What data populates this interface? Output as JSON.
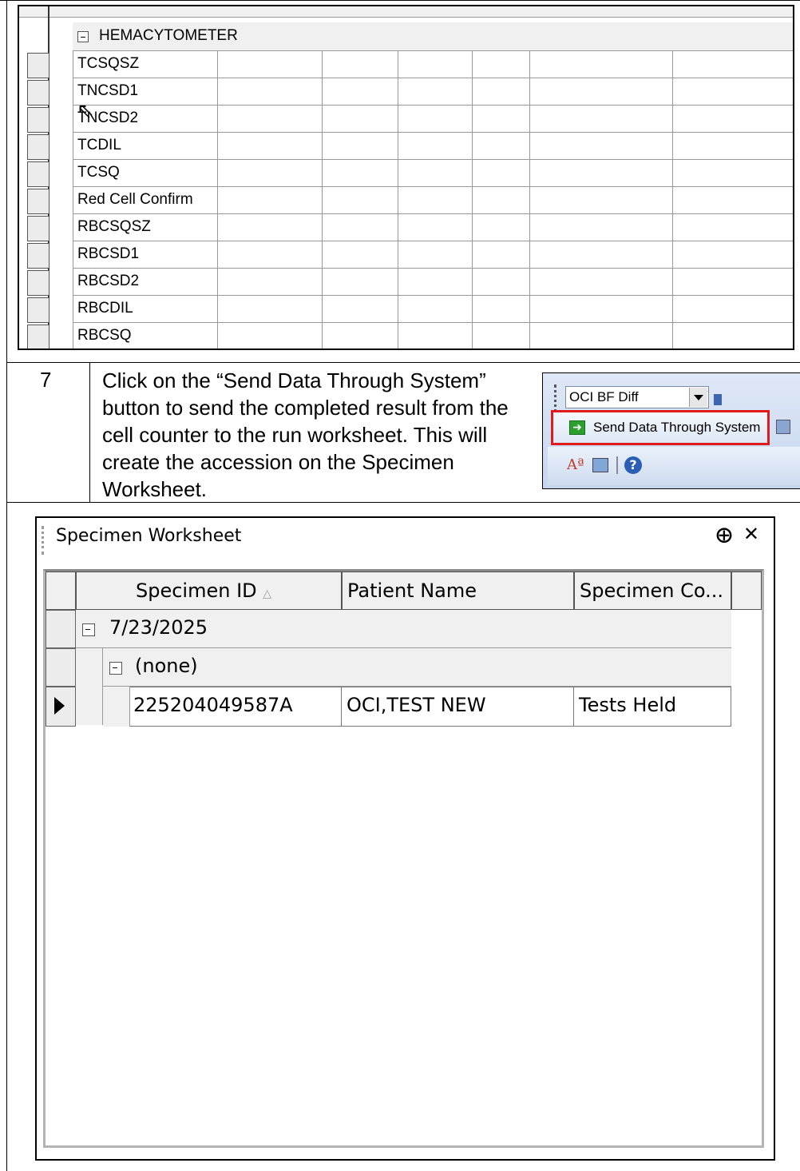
{
  "grid": {
    "group_label": "HEMACYTOMETER",
    "rows": [
      "TCSQSZ",
      "TNCSD1",
      "TNCSD2",
      "TCDIL",
      "TCSQ",
      "Red Cell Confirm",
      "RBCSQSZ",
      "RBCSD1",
      "RBCSD2",
      "RBCDIL",
      "RBCSQ"
    ]
  },
  "step": {
    "number": "7",
    "text": "Click on the “Send Data Through System” button to send the completed result from the cell counter to the run worksheet.  This will create the accession on the Specimen Worksheet."
  },
  "toolbar": {
    "combo_value": "OCI BF Diff",
    "send_button_label": "Send Data Through System"
  },
  "worksheet": {
    "title": "Specimen Worksheet",
    "pin_glyph": "`",
    "close_glyph": "×",
    "columns": [
      "Specimen ID",
      "Patient Name",
      "Specimen Co..."
    ],
    "sort_indicator": "△",
    "group_date": "7/23/2025",
    "subgroup": "(none)",
    "row": {
      "specimen_id": "225204049587A",
      "patient_name": "OCI,TEST NEW",
      "status": "Tests Held"
    }
  }
}
